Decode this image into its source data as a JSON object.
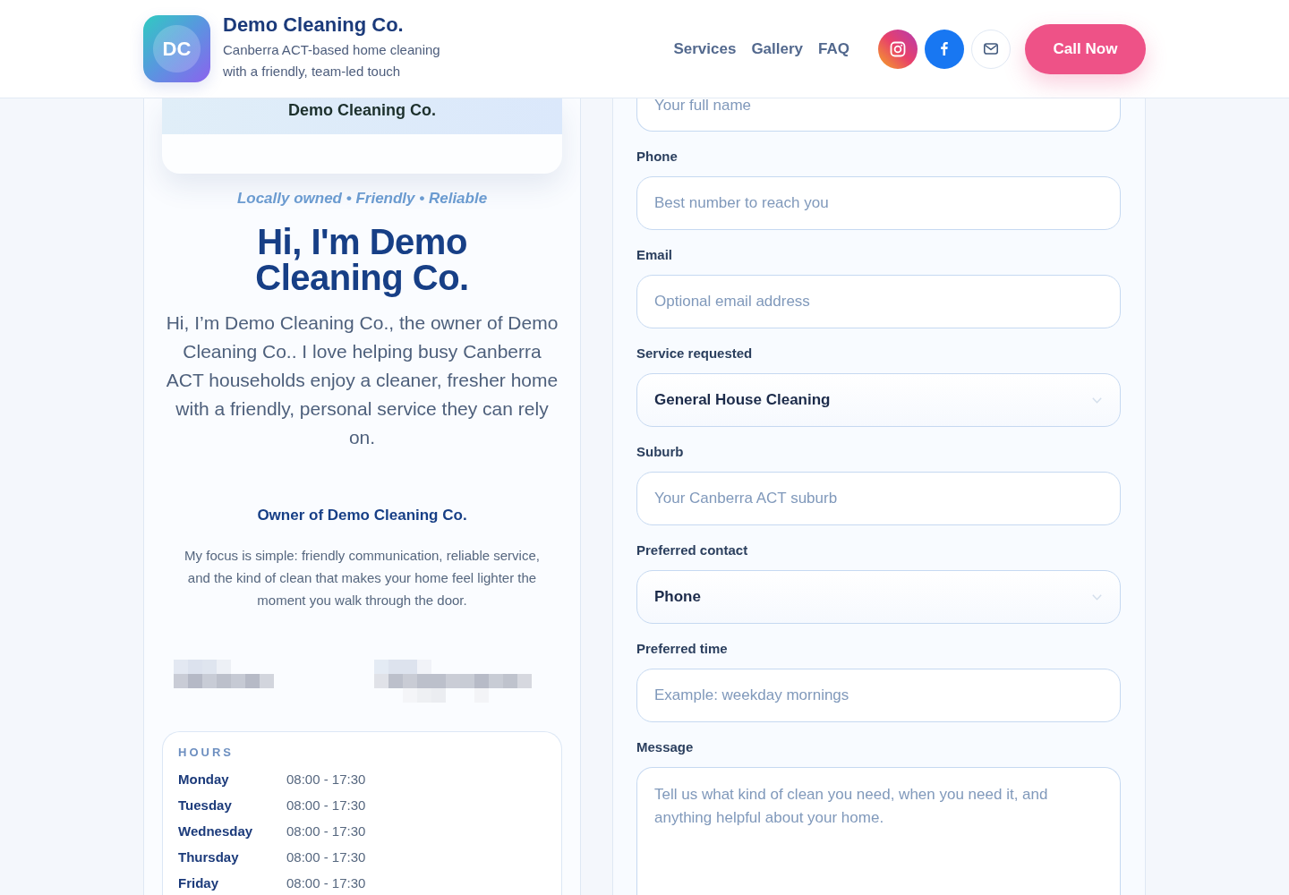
{
  "header": {
    "logo": {
      "initials": "DC"
    },
    "title": "Demo Cleaning Co.",
    "tagline": "Canberra ACT-based home cleaning with a friendly, team-led touch",
    "nav": [
      "Services",
      "Gallery",
      "FAQ"
    ],
    "social": [
      {
        "kind": "instagram"
      },
      {
        "kind": "facebook"
      },
      {
        "kind": "email"
      }
    ],
    "cta": "Call Now"
  },
  "profile": {
    "banner_title": "Demo Cleaning Co.",
    "tagline": "Locally owned • Friendly • Reliable",
    "heading": "Hi, I'm Demo Cleaning Co.",
    "intro": "Hi, I’m Demo Cleaning Co., the owner of Demo Cleaning Co.. I love helping busy Canberra ACT households enjoy a cleaner, fresher home with a friendly, personal service they can rely on.",
    "role": "Owner of Demo Cleaning Co.",
    "bio": "My focus is simple: friendly communication, reliable service, and the kind of clean that makes your home feel lighter the moment you walk through the door.",
    "hours": {
      "title": "HOURS",
      "rows": [
        {
          "day": "Monday",
          "time": "08:00 - 17:30"
        },
        {
          "day": "Tuesday",
          "time": "08:00 - 17:30"
        },
        {
          "day": "Wednesday",
          "time": "08:00 - 17:30"
        },
        {
          "day": "Thursday",
          "time": "08:00 - 17:30"
        },
        {
          "day": "Friday",
          "time": "08:00 - 17:30"
        }
      ]
    }
  },
  "contact_form": {
    "fields": [
      {
        "kind": "input",
        "placeholder": "Your full name"
      },
      {
        "kind": "input",
        "label": "Phone",
        "placeholder": "Best number to reach you"
      },
      {
        "kind": "input",
        "label": "Email",
        "placeholder": "Optional email address"
      },
      {
        "kind": "select",
        "label": "Service requested",
        "value": "General House Cleaning"
      },
      {
        "kind": "input",
        "label": "Suburb",
        "placeholder": "Your Canberra ACT suburb"
      },
      {
        "kind": "select",
        "label": "Preferred contact",
        "value": "Phone"
      },
      {
        "kind": "input",
        "label": "Preferred time",
        "placeholder": "Example: weekday mornings"
      },
      {
        "kind": "textarea",
        "label": "Message",
        "placeholder": "Tell us what kind of clean you need, when you need it, and anything helpful about your home."
      }
    ]
  }
}
